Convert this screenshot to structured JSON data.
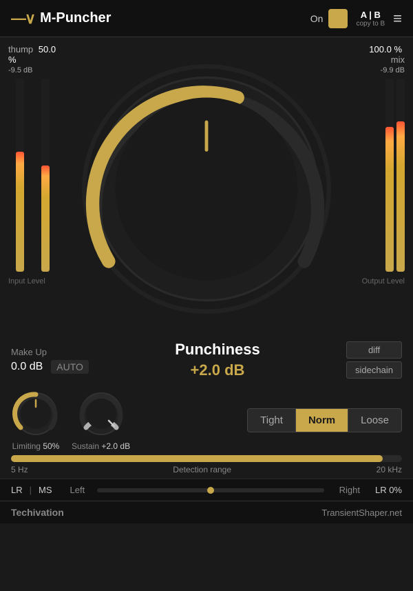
{
  "header": {
    "logo_icon": "—∨",
    "logo_text": "M-Puncher",
    "on_label": "On",
    "ab_label": "A | B",
    "copy_to_b": "copy to B",
    "menu_icon": "≡"
  },
  "input_meter": {
    "label": "thump",
    "percent": "50.0 %",
    "db_top": "-9.5 dB",
    "fill_height": "62",
    "bottom_label": "Input Level"
  },
  "output_meter": {
    "percent": "100.0 %",
    "label": "mix",
    "db_top": "-9.9 dB",
    "fill_height": "78",
    "bottom_label": "Output Level"
  },
  "main_knob": {
    "value_display": "+2.0 dB"
  },
  "punchiness": {
    "title": "Punchiness",
    "value": "+2.0 dB"
  },
  "makeup": {
    "title": "Make Up",
    "db": "0.0 dB",
    "auto": "AUTO"
  },
  "diff_btn": "diff",
  "sidechain_btn": "sidechain",
  "tight_norm_loose": {
    "tight": "Tight",
    "norm": "Norm",
    "loose": "Loose",
    "active": "norm"
  },
  "detection": {
    "label": "Detection range",
    "left": "5 Hz",
    "right": "20 kHz",
    "fill_percent": 95
  },
  "limiting_knob": {
    "label": "Limiting",
    "value": "50%"
  },
  "sustain_knob": {
    "label": "Sustain",
    "value": "+2.0 dB"
  },
  "lr_ms": {
    "lr": "LR",
    "ms": "MS",
    "sep": "|",
    "left": "Left",
    "right": "Right",
    "lr_val": "LR 0%"
  },
  "footer": {
    "left": "Techivation",
    "right": "TransientShaper.net"
  }
}
